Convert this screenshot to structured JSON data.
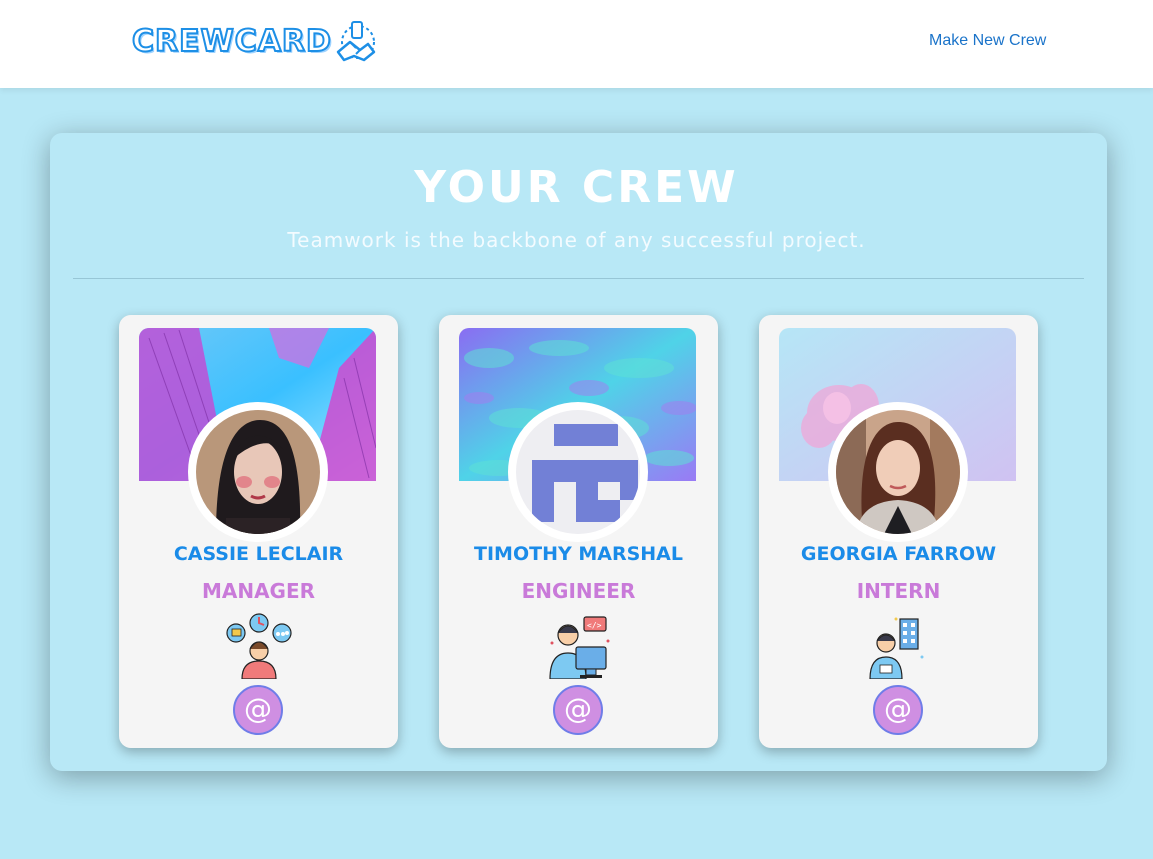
{
  "header": {
    "logo_text": "CREWCARD",
    "nav_link": "Make New Crew"
  },
  "main": {
    "title": "YOUR CREW",
    "subtitle": "Teamwork is the backbone of any successful project."
  },
  "cards": [
    {
      "name": "CASSIE LECLAIR",
      "role": "MANAGER",
      "email_symbol": "@"
    },
    {
      "name": "TIMOTHY MARSHAL",
      "role": "ENGINEER",
      "email_symbol": "@"
    },
    {
      "name": "GEORGIA FARROW",
      "role": "INTERN",
      "email_symbol": "@"
    }
  ],
  "colors": {
    "background": "#b8e8f6",
    "name": "#1a8be8",
    "role": "#c97ad9",
    "email_button": "#cf8fe2",
    "link": "#1a73c9"
  }
}
